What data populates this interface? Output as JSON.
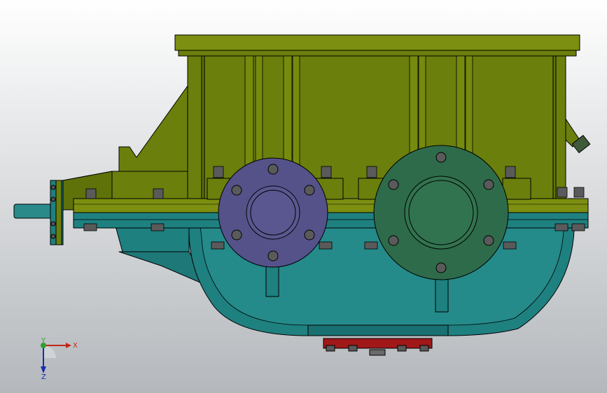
{
  "viewport": {
    "background_top": "#ffffff",
    "background_bottom": "#b4b8bc"
  },
  "model": {
    "name": "gearbox-assembly",
    "colors": {
      "upper_housing": "#6b7f0c",
      "upper_housing_light": "#7c8f10",
      "lower_housing": "#1f8080",
      "lower_housing_light": "#2a9090",
      "input_flange": "#55528a",
      "output_flange": "#2e6b4a",
      "base_plate": "#a01818",
      "bolt": "#5a5a5a",
      "edge": "#000000"
    }
  },
  "triad": {
    "x_label": "X",
    "y_label": "Y",
    "z_label": "Z",
    "x_color": "#c0281c",
    "y_color": "#2fa12f",
    "z_color": "#1c2bb0"
  }
}
